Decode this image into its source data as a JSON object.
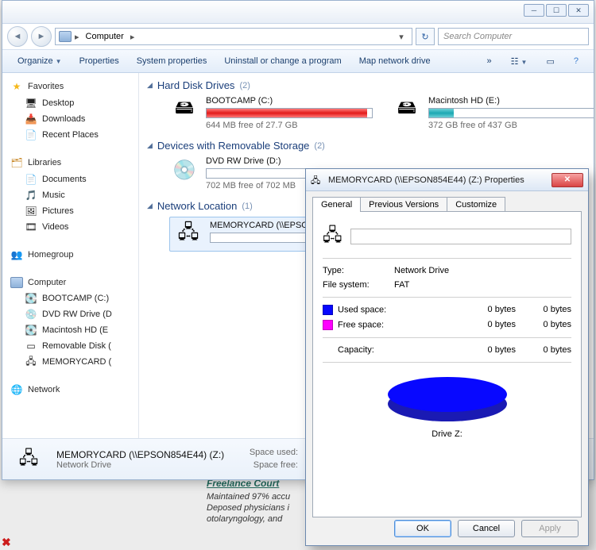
{
  "address": {
    "root_icon": "computer",
    "crumbs": [
      "Computer"
    ]
  },
  "search": {
    "placeholder": "Search Computer"
  },
  "toolbar": {
    "organize": "Organize",
    "properties": "Properties",
    "system_properties": "System properties",
    "uninstall": "Uninstall or change a program",
    "map_drive": "Map network drive",
    "overflow": "»"
  },
  "sidebar": {
    "favorites": {
      "label": "Favorites",
      "items": [
        "Desktop",
        "Downloads",
        "Recent Places"
      ]
    },
    "libraries": {
      "label": "Libraries",
      "items": [
        "Documents",
        "Music",
        "Pictures",
        "Videos"
      ]
    },
    "homegroup": {
      "label": "Homegroup"
    },
    "computer": {
      "label": "Computer",
      "items": [
        "BOOTCAMP (C:)",
        "DVD RW Drive (D",
        "Macintosh HD (E",
        "Removable Disk (",
        "MEMORYCARD ("
      ]
    },
    "network": {
      "label": "Network"
    }
  },
  "sections": {
    "hdd": {
      "title": "Hard Disk Drives",
      "count": "(2)",
      "drives": [
        {
          "name": "BOOTCAMP (C:)",
          "free": "644 MB free of 27.7 GB",
          "fill_pct": 97,
          "color": "red"
        },
        {
          "name": "Macintosh HD (E:)",
          "free": "372 GB free of 437 GB",
          "fill_pct": 15,
          "color": "teal"
        }
      ]
    },
    "removable": {
      "title": "Devices with Removable Storage",
      "count": "(2)",
      "drives": [
        {
          "name": "DVD RW Drive (D:)",
          "free": "702 MB free of 702 MB",
          "fill_pct": 0,
          "color": "white",
          "icon": "cd"
        }
      ]
    },
    "network": {
      "title": "Network Location",
      "count": "(1)",
      "drives": [
        {
          "name": "MEMORYCARD (\\\\EPSON854E44) (Z:)",
          "free": "",
          "fill_pct": 0,
          "color": "white",
          "icon": "netdrive"
        }
      ]
    }
  },
  "details": {
    "title": "MEMORYCARD (\\\\EPSON854E44) (Z:)",
    "subtitle": "Network Drive",
    "stat1": "Space used:",
    "stat2": "Space free:"
  },
  "properties_dialog": {
    "title": "MEMORYCARD (\\\\EPSON854E44) (Z:) Properties",
    "tabs": [
      "General",
      "Previous Versions",
      "Customize"
    ],
    "active_tab": 0,
    "type_label": "Type:",
    "type_value": "Network Drive",
    "fs_label": "File system:",
    "fs_value": "FAT",
    "used_label": "Used space:",
    "used_v1": "0 bytes",
    "used_v2": "0 bytes",
    "free_label": "Free space:",
    "free_v1": "0 bytes",
    "free_v2": "0 bytes",
    "capacity_label": "Capacity:",
    "capacity_v1": "0 bytes",
    "capacity_v2": "0 bytes",
    "pie_label": "Drive Z:",
    "buttons": {
      "ok": "OK",
      "cancel": "Cancel",
      "apply": "Apply"
    }
  },
  "background_doc": {
    "heading": "Freelance Court",
    "lines": [
      "Maintained 97% accu",
      "Deposed physicians i",
      "otolaryngology, and"
    ]
  },
  "chart_data": {
    "type": "pie",
    "title": "Drive Z:",
    "series": [
      {
        "name": "Used space",
        "value": 0,
        "unit": "bytes",
        "color": "#0000ff"
      },
      {
        "name": "Free space",
        "value": 0,
        "unit": "bytes",
        "color": "#ff00ff"
      }
    ],
    "capacity": {
      "value": 0,
      "unit": "bytes"
    }
  }
}
